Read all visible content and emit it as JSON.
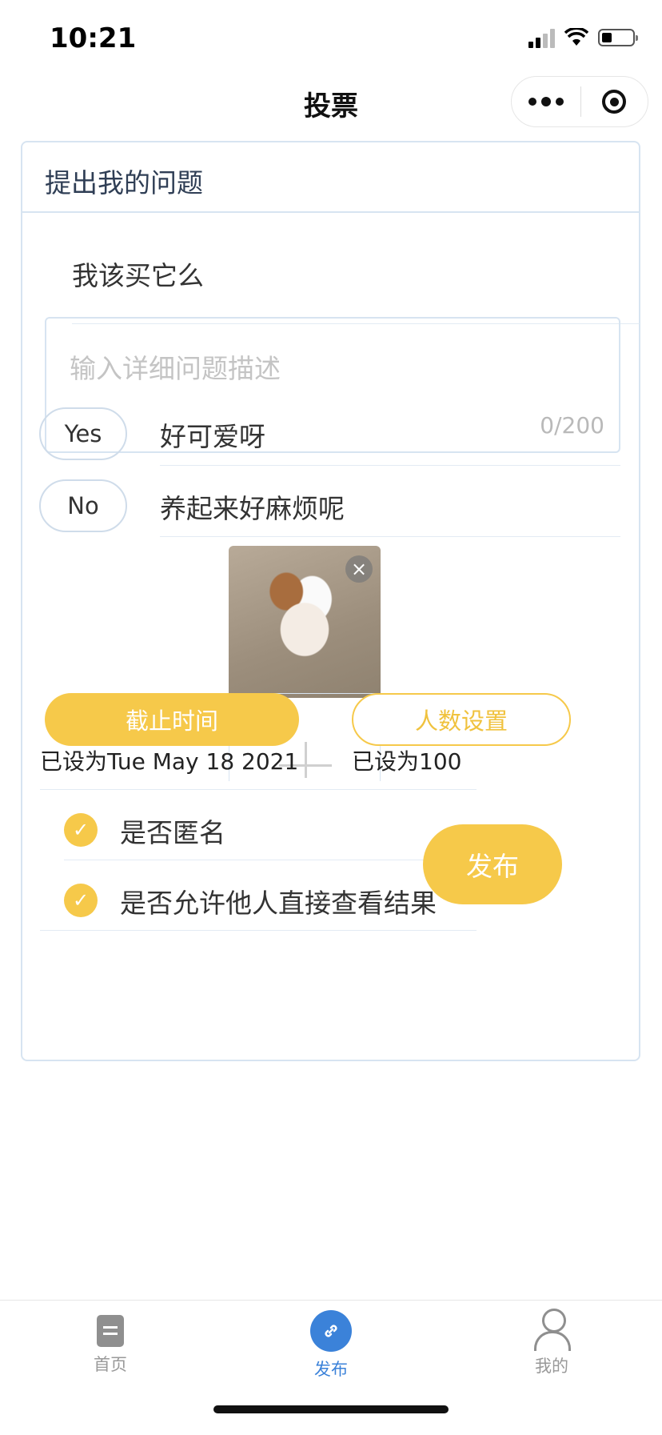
{
  "status_bar": {
    "time": "10:21"
  },
  "nav": {
    "title": "投票"
  },
  "form": {
    "section_title": "提出我的问题",
    "question": "我该买它么",
    "description_placeholder": "输入详细问题描述",
    "description_count": "0/200",
    "options": [
      {
        "tag": "Yes",
        "text": "好可爱呀"
      },
      {
        "tag": "No",
        "text": "养起来好麻烦呢"
      }
    ],
    "photo_close": "×",
    "deadline_button": "截止时间",
    "deadline_value": "已设为Tue May 18 2021",
    "count_button": "人数设置",
    "count_value": "已设为100",
    "check_mark": "✓",
    "anonymous_label": "是否匿名",
    "view_result_label": "是否允许他人直接查看结果",
    "publish_button": "发布"
  },
  "tabbar": {
    "items": [
      {
        "label": "首页",
        "icon": "document-icon",
        "active": false
      },
      {
        "label": "发布",
        "icon": "link-icon",
        "active": true
      },
      {
        "label": "我的",
        "icon": "user-icon",
        "active": false
      }
    ],
    "active_color": "#3b82d9"
  },
  "colors": {
    "accent": "#f6c94a",
    "border": "#d7e4f1"
  }
}
